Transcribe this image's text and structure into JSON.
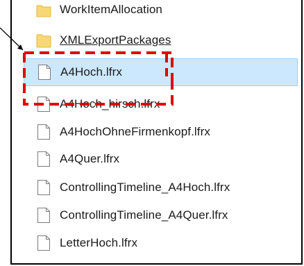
{
  "file_list": {
    "items": [
      {
        "name": "WorkItemAllocation",
        "type": "folder"
      },
      {
        "name": "XMLExportPackages",
        "type": "folder"
      },
      {
        "name": "A4Hoch.lfrx",
        "type": "file",
        "selected": true
      },
      {
        "name": "A4Hoch_hirsch.lfrx",
        "type": "file"
      },
      {
        "name": "A4HochOhneFirmenkopf.lfrx",
        "type": "file"
      },
      {
        "name": "A4Quer.lfrx",
        "type": "file"
      },
      {
        "name": "ControllingTimeline_A4Hoch.lfrx",
        "type": "file"
      },
      {
        "name": "ControllingTimeline_A4Quer.lfrx",
        "type": "file"
      },
      {
        "name": "LetterHoch.lfrx",
        "type": "file"
      }
    ]
  },
  "colors": {
    "selection_bg": "#cce8ff",
    "selection_border": "#99d1ff",
    "folder": "#f8d775",
    "annotation": "#e00000"
  },
  "icons": {
    "folder": "folder-icon",
    "file": "file-icon"
  }
}
